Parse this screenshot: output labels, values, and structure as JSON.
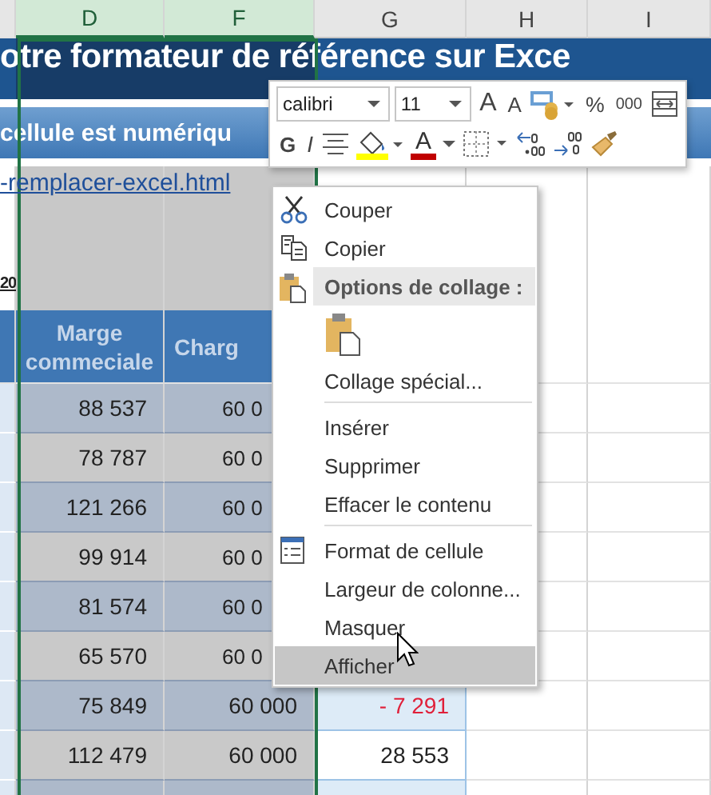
{
  "column_headers": [
    {
      "label": "D",
      "selected": true
    },
    {
      "label": "F",
      "selected": true
    },
    {
      "label": "G",
      "selected": false
    },
    {
      "label": "H",
      "selected": false
    },
    {
      "label": "I",
      "selected": false
    }
  ],
  "title": "otre formateur de référence sur Exce",
  "subtitle": "cellule est numériqu",
  "link": "-remplacer-excel.html",
  "note": "20",
  "table": {
    "columns": [
      "Marge commeciale",
      "Charg"
    ],
    "rows": [
      {
        "marge": "88 537",
        "charges": "60 0"
      },
      {
        "marge": "78 787",
        "charges": "60 0"
      },
      {
        "marge": "121 266",
        "charges": "60 0"
      },
      {
        "marge": "99 914",
        "charges": "60 0"
      },
      {
        "marge": "81 574",
        "charges": "60 0"
      },
      {
        "marge": "65 570",
        "charges": "60 0"
      },
      {
        "marge": "75 849",
        "charges": "60 000",
        "result": "- 7 291",
        "negative": true
      },
      {
        "marge": "112 479",
        "charges": "60 000",
        "result": "28 553",
        "negative": false
      }
    ]
  },
  "mini_toolbar": {
    "font": "calibri",
    "size": "11",
    "grow": "A",
    "shrink": "A",
    "percent": "%",
    "thousands": "000",
    "bold": "G",
    "italic": "I",
    "font_color": "A"
  },
  "context_menu": [
    {
      "kind": "cut",
      "label": "Couper",
      "separator_before": false,
      "highlighted": false
    },
    {
      "kind": "copy",
      "label": "Copier",
      "separator_before": false,
      "highlighted": false
    },
    {
      "kind": "header",
      "label": "Options de collage :"
    },
    {
      "kind": "paste"
    },
    {
      "kind": "plain",
      "label": "Collage spécial...",
      "separator_before": false,
      "highlighted": false
    },
    {
      "kind": "plain",
      "label": "Insérer",
      "separator_before": true,
      "highlighted": false
    },
    {
      "kind": "plain",
      "label": "Supprimer",
      "separator_before": false,
      "highlighted": false
    },
    {
      "kind": "plain",
      "label": "Effacer le contenu",
      "separator_before": false,
      "highlighted": false
    },
    {
      "kind": "format",
      "label": "Format de cellule",
      "separator_before": true,
      "highlighted": false
    },
    {
      "kind": "plain",
      "label": "Largeur de colonne...",
      "separator_before": false,
      "highlighted": false
    },
    {
      "kind": "plain",
      "label": "Masquer",
      "separator_before": false,
      "highlighted": false
    },
    {
      "kind": "plain",
      "label": "Afficher",
      "separator_before": false,
      "highlighted": true
    }
  ]
}
